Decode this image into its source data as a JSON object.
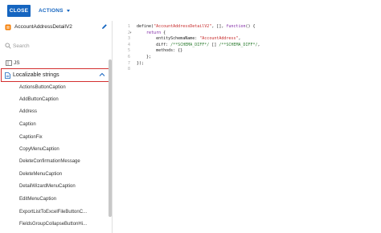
{
  "toolbar": {
    "close_label": "CLOSE",
    "actions_label": "ACTIONS"
  },
  "sidebar": {
    "schema_name": "AccountAddressDetailV2",
    "search_placeholder": "Search",
    "sections": {
      "js": "JS",
      "localizable": "Localizable strings"
    },
    "items": [
      "ActionsButtonCaption",
      "AddButtonCaption",
      "Address",
      "Caption",
      "CaptionFix",
      "CopyMenuCaption",
      "DeleteConfirmationMessage",
      "DeleteMenuCaption",
      "DetailWizardMenuCaption",
      "EditMenuCaption",
      "ExportListToExcelFileButtonC...",
      "FieldsGroupCollapseButtonHi..."
    ]
  },
  "editor": {
    "line_numbers": [
      "1",
      "2",
      "3",
      "4",
      "5",
      "6",
      "7",
      "8"
    ],
    "lines": [
      [
        {
          "t": "define(",
          "c": ""
        },
        {
          "t": "\"AccountAddressDetailV2\"",
          "c": "str"
        },
        {
          "t": ", [], ",
          "c": ""
        },
        {
          "t": "function",
          "c": "kw"
        },
        {
          "t": "() {",
          "c": ""
        }
      ],
      [
        {
          "t": "    ",
          "c": ""
        },
        {
          "t": "return",
          "c": "kw"
        },
        {
          "t": " {",
          "c": ""
        }
      ],
      [
        {
          "t": "        entitySchemaName: ",
          "c": ""
        },
        {
          "t": "\"AccountAddress\"",
          "c": "str"
        },
        {
          "t": ",",
          "c": ""
        }
      ],
      [
        {
          "t": "        diff: ",
          "c": ""
        },
        {
          "t": "/**SCHEMA_DIFF*/",
          "c": "cm"
        },
        {
          "t": " [] ",
          "c": ""
        },
        {
          "t": "/**SCHEMA_DIFF*/",
          "c": "cm"
        },
        {
          "t": ",",
          "c": ""
        }
      ],
      [
        {
          "t": "        methods: {}",
          "c": ""
        }
      ],
      [
        {
          "t": "    };",
          "c": ""
        }
      ],
      [
        {
          "t": "});",
          "c": ""
        }
      ],
      [
        {
          "t": "",
          "c": ""
        }
      ]
    ]
  },
  "colors": {
    "primary": "#1565c0",
    "highlight_border": "#d32f2f"
  }
}
